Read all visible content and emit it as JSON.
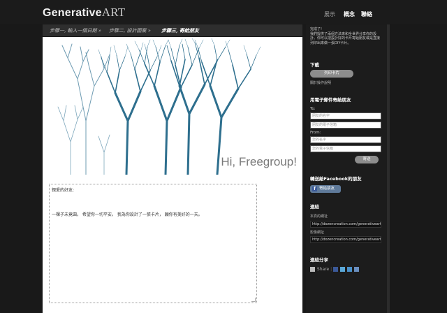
{
  "brand": {
    "name_a": "Generative",
    "name_b": "ART"
  },
  "nav": {
    "item1": "展示",
    "item2": "概念",
    "item3": "聯絡"
  },
  "steps": {
    "s1": "步驟一, 輸入一個日期 »",
    "s2": "步驟二, 設計圖案 »",
    "s3": "步驟三, 寄給朋友"
  },
  "card": {
    "greeting": "Hi, Freegroup!"
  },
  "message": {
    "line1": "親愛的好友:",
    "line2": "一棵子未竟園。 希望你一切平安。 我為你設計了一張卡片， 願你有美好的一天。"
  },
  "sidebar": {
    "intro": "完成了!\n我們提供了兩個方法來和全世界分享你的設計。你可以把設計好的卡片寄給朋友或是直接列印出來做一張DIY卡片。",
    "download_title": "下載",
    "print_button": "列印卡片",
    "print_help": "關於操作說明",
    "email_title": "用電子郵件寄給朋友",
    "to_label": "To:",
    "friend_name_ph": "朋友的名字",
    "friend_email_ph": "朋友的電子信箱",
    "from_label": "From:",
    "your_name_ph": "您的名字",
    "your_email_ph": "您的電子信箱",
    "send_button": "寄送",
    "fb_title": "轉送給Facebook的朋友",
    "fb_button": "寄給朋友",
    "links_title": "連結",
    "page_url_label": "本頁的網址",
    "page_url": "http://dozencreation.com/generativeart/se",
    "image_url_label": "影像網址",
    "image_url": "http://dozencreation.com/generativeart/su",
    "share_title": "連結分享",
    "share_label": "Share"
  },
  "colors": {
    "tree": "#2e6f8e",
    "bg": "#191919",
    "card": "#ffffff"
  }
}
